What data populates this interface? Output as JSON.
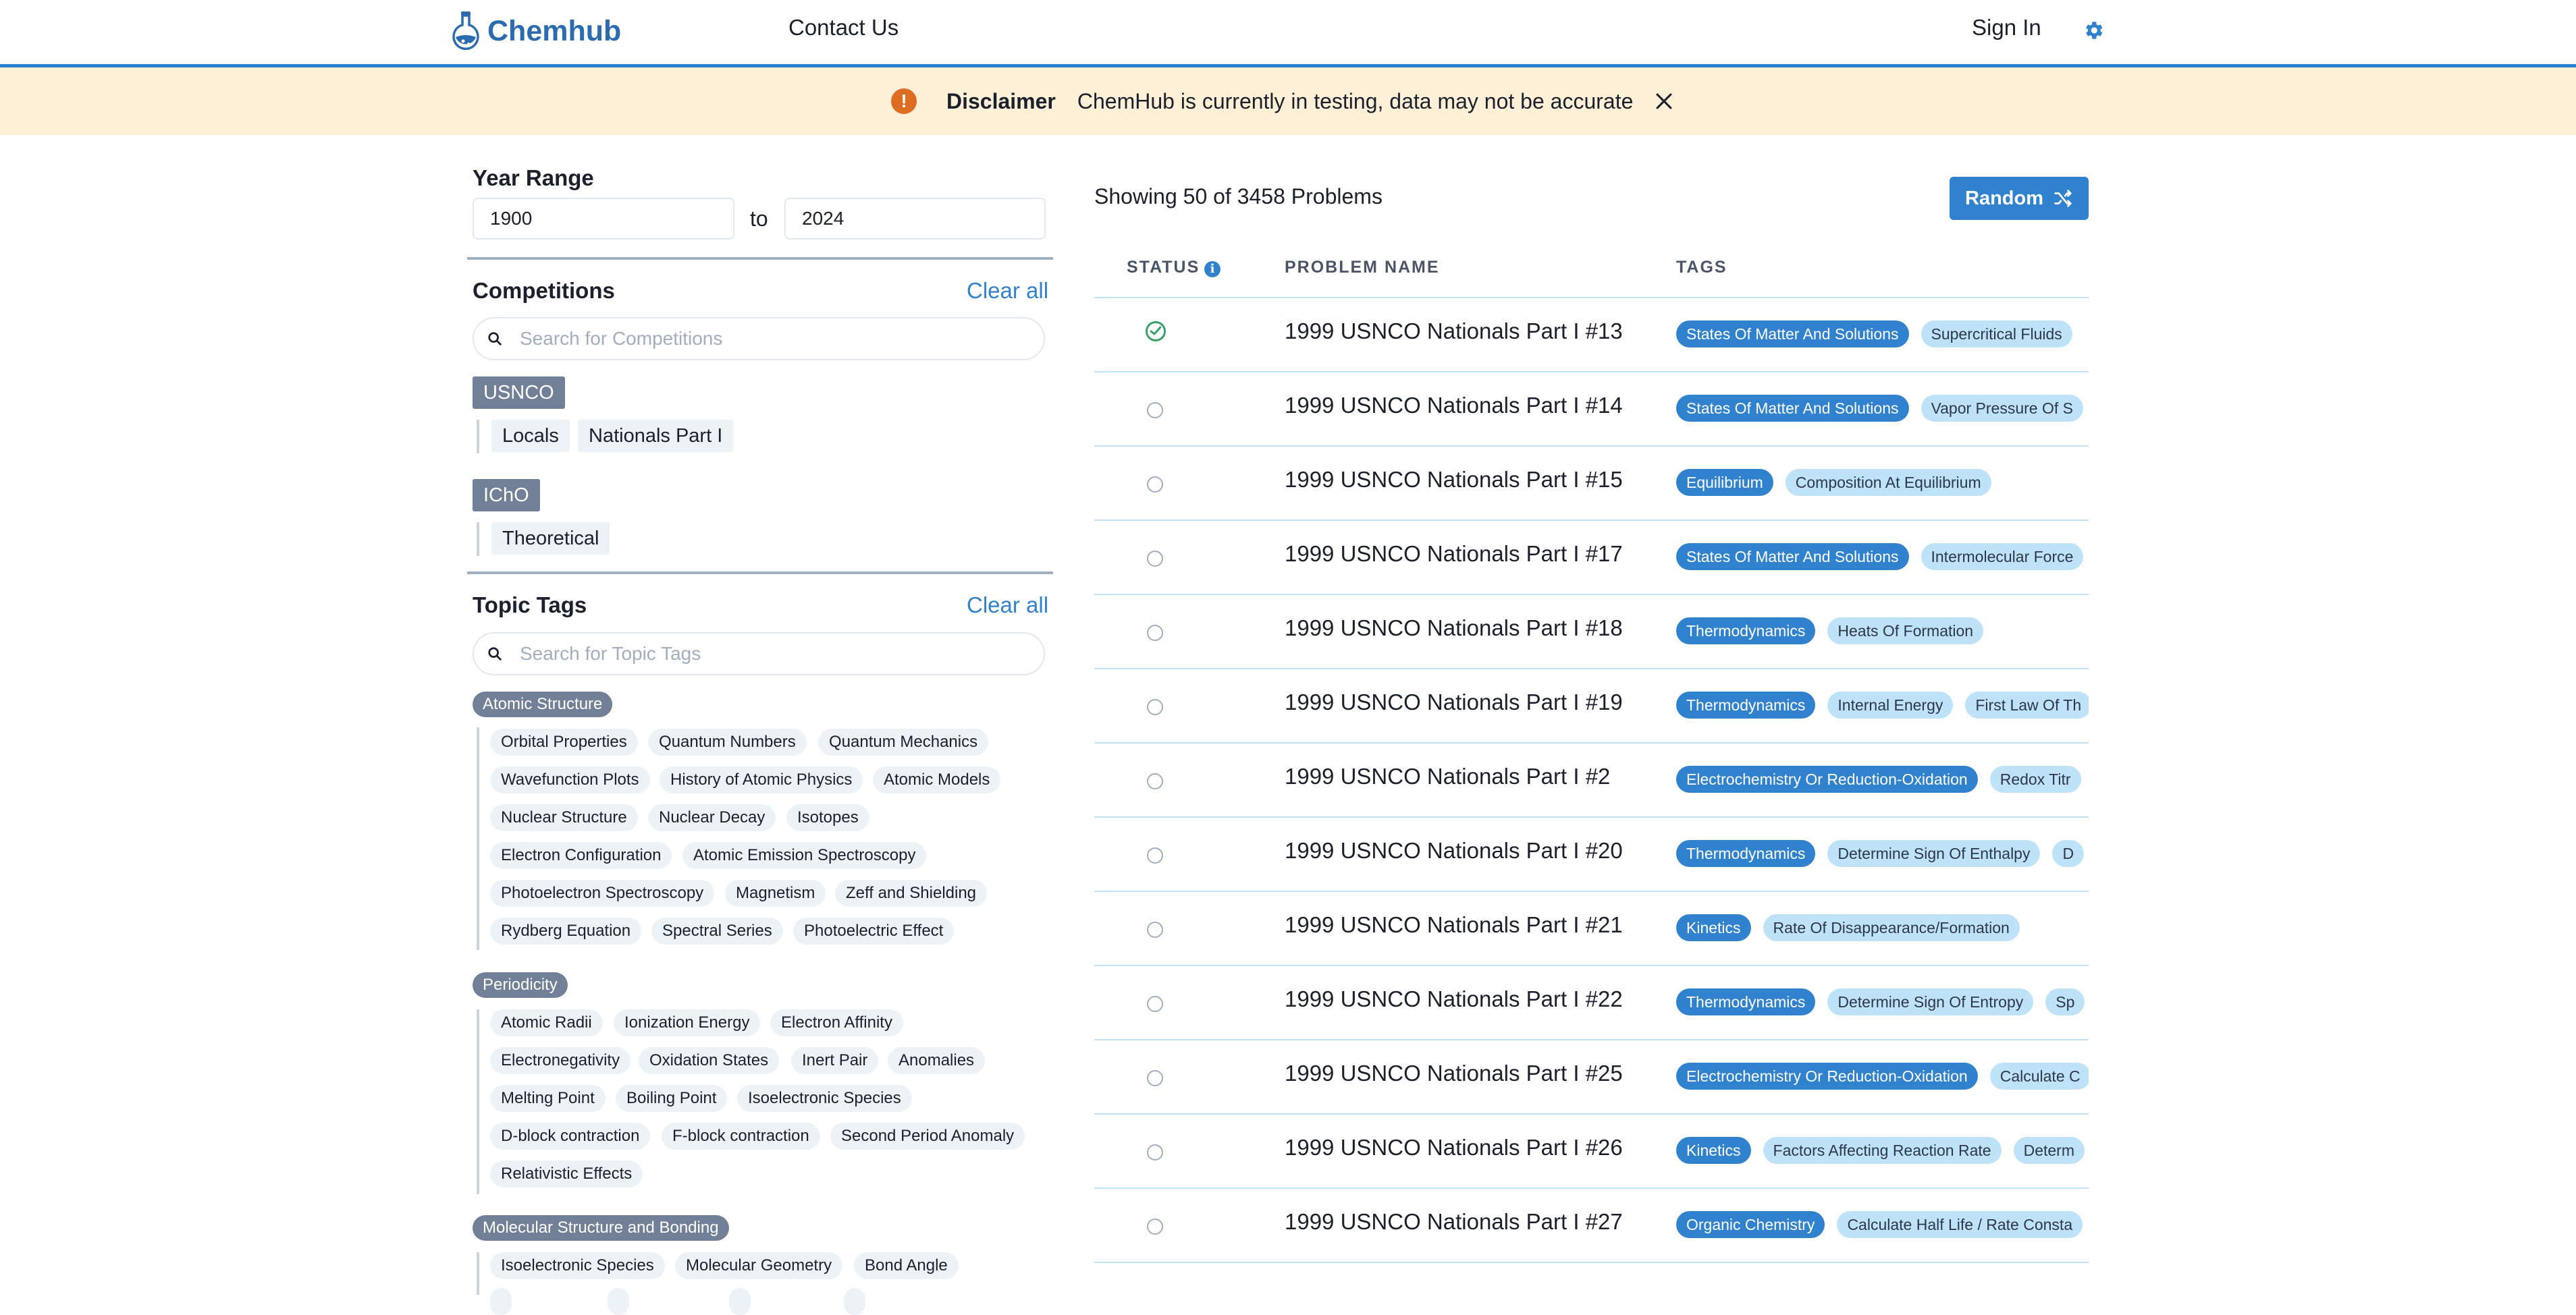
{
  "header": {
    "logo_text": "Chemhub",
    "nav": {
      "contact": "Contact Us",
      "sign_in": "Sign In"
    },
    "accent_color": "#3182ce"
  },
  "disclaimer": {
    "title": "Disclaimer",
    "text": "ChemHub is currently in testing, data may not be accurate",
    "icon": "warning-circle-icon"
  },
  "filters": {
    "year_range": {
      "title": "Year Range",
      "from": "1900",
      "to_label": "to",
      "to": "2024"
    },
    "competitions": {
      "title": "Competitions",
      "clear_label": "Clear all",
      "search_placeholder": "Search for Competitions",
      "groups": [
        {
          "name": "USNCO",
          "items": [
            "Locals",
            "Nationals Part I"
          ]
        },
        {
          "name": "IChO",
          "items": [
            "Theoretical"
          ]
        }
      ]
    },
    "topic_tags": {
      "title": "Topic Tags",
      "clear_label": "Clear all",
      "search_placeholder": "Search for Topic Tags",
      "groups": [
        {
          "name": "Atomic Structure",
          "rows": [
            [
              "Orbital Properties",
              "Quantum Numbers",
              "Quantum Mechanics"
            ],
            [
              "Wavefunction Plots",
              "History of Atomic Physics",
              "Atomic Models"
            ],
            [
              "Nuclear Structure",
              "Nuclear Decay",
              "Isotopes"
            ],
            [
              "Electron Configuration",
              "Atomic Emission Spectroscopy"
            ],
            [
              "Photoelectron Spectroscopy",
              "Magnetism",
              "Zeff and Shielding"
            ],
            [
              "Rydberg Equation",
              "Spectral Series",
              "Photoelectric Effect"
            ]
          ]
        },
        {
          "name": "Periodicity",
          "rows": [
            [
              "Atomic Radii",
              "Ionization Energy",
              "Electron Affinity"
            ],
            [
              "Electronegativity",
              "Oxidation States",
              "Inert Pair",
              "Anomalies"
            ],
            [
              "Melting Point",
              "Boiling Point",
              "Isoelectronic Species"
            ],
            [
              "D-block contraction",
              "F-block contraction",
              "Second Period Anomaly"
            ],
            [
              "Relativistic Effects"
            ]
          ]
        },
        {
          "name": "Molecular Structure and Bonding",
          "rows": [
            [
              "Isoelectronic Species",
              "Molecular Geometry",
              "Bond Angle"
            ]
          ]
        }
      ]
    }
  },
  "results": {
    "showing_text": "Showing 50 of 3458 Problems",
    "random_label": "Random",
    "columns": {
      "status": "STATUS",
      "name": "PROBLEM NAME",
      "tags": "TAGS"
    },
    "rows": [
      {
        "solved": true,
        "name": "1999 USNCO Nationals Part I #13",
        "tags": [
          "States Of Matter And Solutions",
          "Supercritical Fluids"
        ]
      },
      {
        "solved": false,
        "name": "1999 USNCO Nationals Part I #14",
        "tags": [
          "States Of Matter And Solutions",
          "Vapor Pressure Of S"
        ]
      },
      {
        "solved": false,
        "name": "1999 USNCO Nationals Part I #15",
        "tags": [
          "Equilibrium",
          "Composition At Equilibrium"
        ]
      },
      {
        "solved": false,
        "name": "1999 USNCO Nationals Part I #17",
        "tags": [
          "States Of Matter And Solutions",
          "Intermolecular Force"
        ]
      },
      {
        "solved": false,
        "name": "1999 USNCO Nationals Part I #18",
        "tags": [
          "Thermodynamics",
          "Heats Of Formation"
        ]
      },
      {
        "solved": false,
        "name": "1999 USNCO Nationals Part I #19",
        "tags": [
          "Thermodynamics",
          "Internal Energy",
          "First Law Of Th"
        ]
      },
      {
        "solved": false,
        "name": "1999 USNCO Nationals Part I #2",
        "tags": [
          "Electrochemistry Or Reduction-Oxidation",
          "Redox Titr"
        ]
      },
      {
        "solved": false,
        "name": "1999 USNCO Nationals Part I #20",
        "tags": [
          "Thermodynamics",
          "Determine Sign Of Enthalpy",
          "D"
        ]
      },
      {
        "solved": false,
        "name": "1999 USNCO Nationals Part I #21",
        "tags": [
          "Kinetics",
          "Rate Of Disappearance/Formation"
        ]
      },
      {
        "solved": false,
        "name": "1999 USNCO Nationals Part I #22",
        "tags": [
          "Thermodynamics",
          "Determine Sign Of Entropy",
          "Sp"
        ]
      },
      {
        "solved": false,
        "name": "1999 USNCO Nationals Part I #25",
        "tags": [
          "Electrochemistry Or Reduction-Oxidation",
          "Calculate C"
        ]
      },
      {
        "solved": false,
        "name": "1999 USNCO Nationals Part I #26",
        "tags": [
          "Kinetics",
          "Factors Affecting Reaction Rate",
          "Determ"
        ]
      },
      {
        "solved": false,
        "name": "1999 USNCO Nationals Part I #27",
        "tags": [
          "Organic Chemistry",
          "Calculate Half Life / Rate Consta"
        ]
      }
    ]
  }
}
